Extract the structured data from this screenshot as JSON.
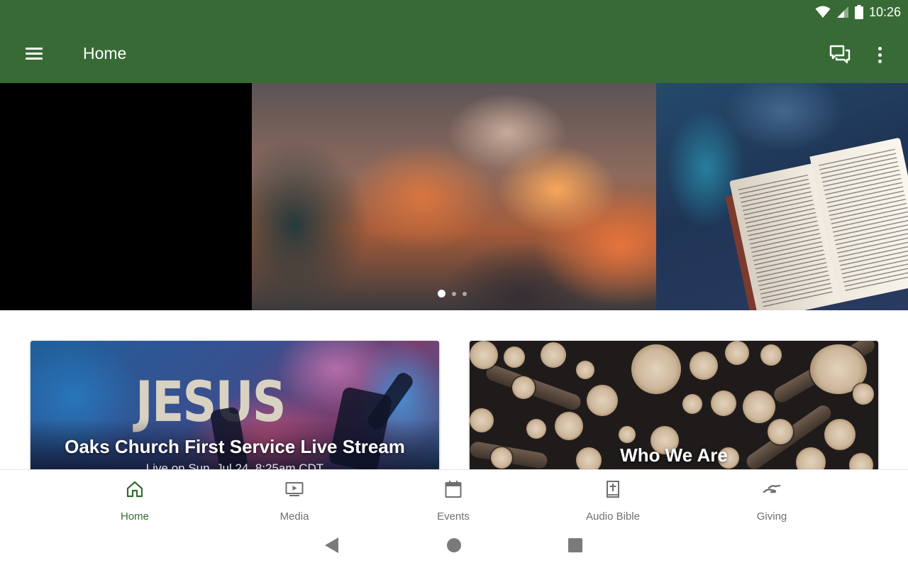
{
  "status_bar": {
    "time": "10:26"
  },
  "app_bar": {
    "title": "Home"
  },
  "carousel": {
    "slide_count": 3,
    "active_index": 0
  },
  "cards": [
    {
      "title": "Oaks Church First Service Live Stream",
      "subtitle": "Live on Sun, Jul 24, 8:25am CDT",
      "image_text": "JESUS"
    },
    {
      "title": "Who We Are"
    }
  ],
  "bottom_nav": {
    "items": [
      {
        "label": "Home",
        "icon": "home-icon",
        "active": true
      },
      {
        "label": "Media",
        "icon": "media-icon",
        "active": false
      },
      {
        "label": "Events",
        "icon": "calendar-icon",
        "active": false
      },
      {
        "label": "Audio Bible",
        "icon": "bible-icon",
        "active": false
      },
      {
        "label": "Giving",
        "icon": "giving-icon",
        "active": false
      }
    ]
  },
  "colors": {
    "primary": "#386a35",
    "nav_inactive": "#6f6f6f"
  }
}
